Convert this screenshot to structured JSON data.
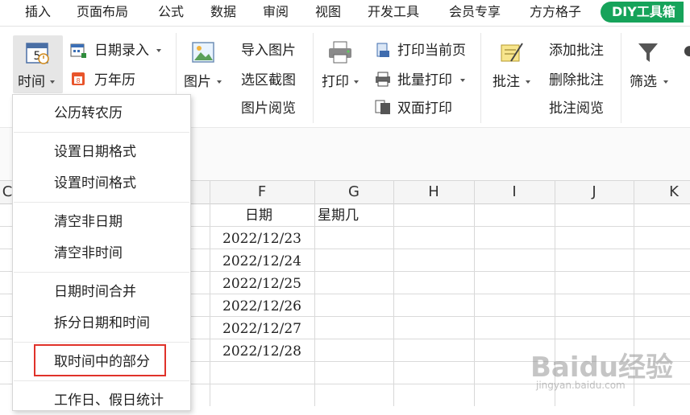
{
  "menu": {
    "tabs": [
      "插入",
      "页面布局",
      "公式",
      "数据",
      "审阅",
      "视图",
      "开发工具",
      "会员专享",
      "方方格子"
    ],
    "active_tab": "DIY工具箱"
  },
  "ribbon": {
    "time": {
      "label": "时间"
    },
    "date_entry": {
      "label": "日期录入"
    },
    "calendar": {
      "label": "万年历"
    },
    "picture": {
      "label": "图片"
    },
    "import_picture": {
      "label": "导入图片"
    },
    "area_screenshot": {
      "label": "选区截图"
    },
    "picture_view": {
      "label": "图片阅览"
    },
    "print": {
      "label": "打印"
    },
    "print_current": {
      "label": "打印当前页"
    },
    "batch_print": {
      "label": "批量打印"
    },
    "duplex_print": {
      "label": "双面打印"
    },
    "comment": {
      "label": "批注"
    },
    "add_comment": {
      "label": "添加批注"
    },
    "delete_comment": {
      "label": "删除批注"
    },
    "comment_view": {
      "label": "批注阅览"
    },
    "filter": {
      "label": "筛选"
    }
  },
  "dropdown": {
    "items": [
      "公历转农历",
      "设置日期格式",
      "设置时间格式",
      "清空非日期",
      "清空非时间",
      "日期时间合并",
      "拆分日期和时间",
      "取时间中的部分",
      "工作日、假日统计"
    ],
    "highlighted_index": 7
  },
  "sheet": {
    "columns": [
      "C",
      "F",
      "G",
      "H",
      "I",
      "J",
      "K"
    ],
    "header_row": {
      "F": "日期",
      "G": "星期几"
    },
    "dates": [
      "2022/12/23",
      "2022/12/24",
      "2022/12/25",
      "2022/12/26",
      "2022/12/27",
      "2022/12/28"
    ]
  },
  "colors": {
    "accent": "#16a35a",
    "highlight_border": "#e0322a"
  },
  "watermark": {
    "text": "Baidu经验",
    "url": "jingyan.baidu.com"
  }
}
